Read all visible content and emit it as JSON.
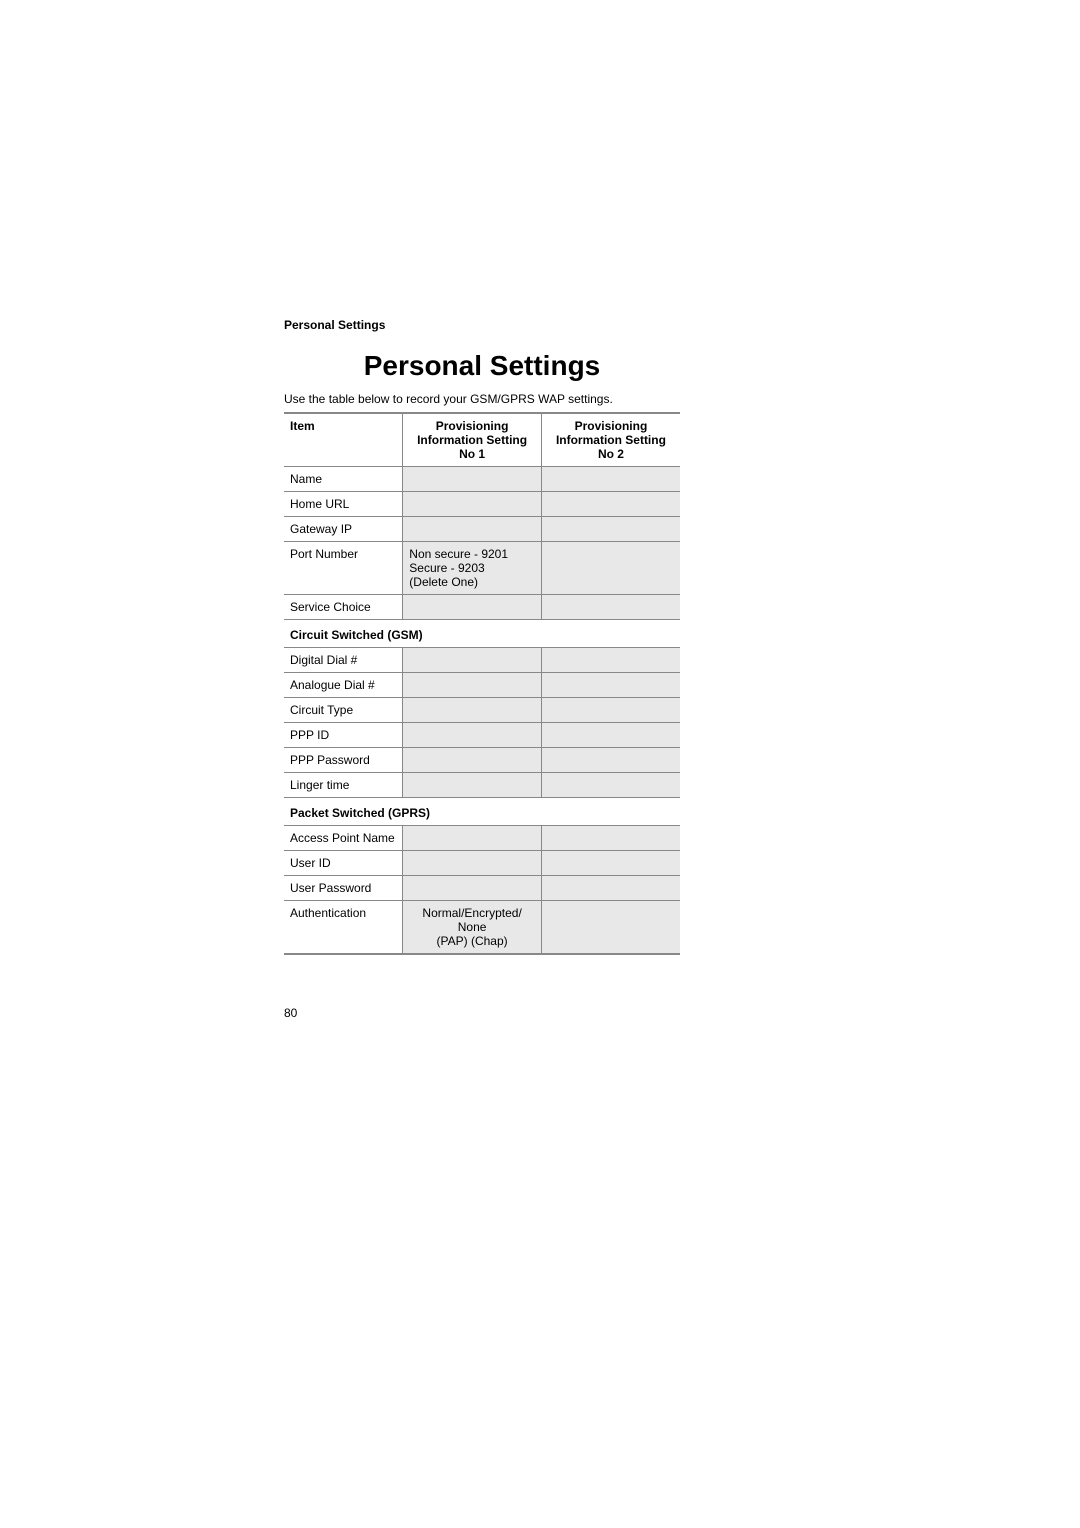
{
  "header": "Personal Settings",
  "title": "Personal Settings",
  "subtitle": "Use the table below to record your GSM/GPRS WAP settings.",
  "columns": {
    "c1": "Item",
    "c2": "Provisioning Information Setting No 1",
    "c3": "Provisioning Information Setting No 2"
  },
  "rows": {
    "r1": {
      "label": "Name"
    },
    "r2": {
      "label": "Home URL"
    },
    "r3": {
      "label": "Gateway IP"
    },
    "r4": {
      "label": "Port Number",
      "value": "Non secure - 9201\nSecure - 9203\n(Delete One)"
    },
    "r5": {
      "label": "Service Choice"
    },
    "s1": "Circuit Switched (GSM)",
    "r6": {
      "label": "Digital Dial #"
    },
    "r7": {
      "label": "Analogue Dial #"
    },
    "r8": {
      "label": "Circuit Type"
    },
    "r9": {
      "label": "PPP ID"
    },
    "r10": {
      "label": "PPP Password"
    },
    "r11": {
      "label": "Linger time"
    },
    "s2": "Packet Switched (GPRS)",
    "r12": {
      "label": "Access Point Name"
    },
    "r13": {
      "label": "User ID"
    },
    "r14": {
      "label": "User Password"
    },
    "r15": {
      "label": "Authentication",
      "value": "Normal/Encrypted/\nNone\n(PAP)   (Chap)"
    }
  },
  "page_number": "80"
}
